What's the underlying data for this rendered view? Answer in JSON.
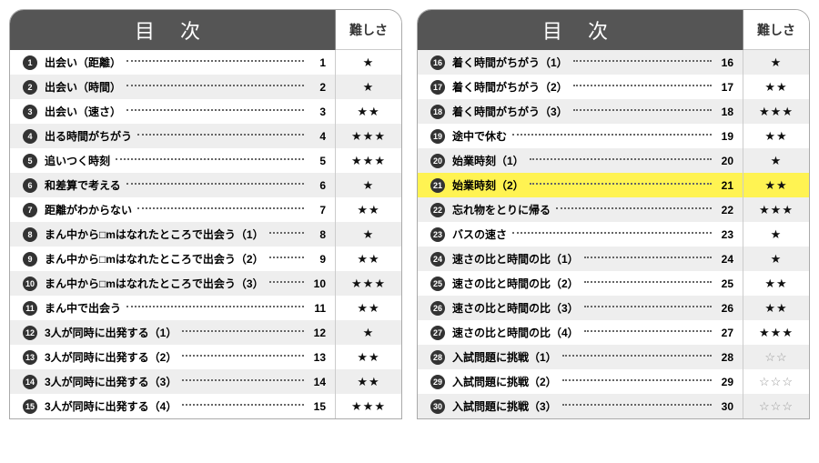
{
  "header": {
    "title": "目 次",
    "difficulty": "難しさ"
  },
  "stars": {
    "filled": "★",
    "open": "☆"
  },
  "left": [
    {
      "n": 1,
      "title": "出会い（距離）",
      "page": 1,
      "stars": 1,
      "open": false,
      "alt": false
    },
    {
      "n": 2,
      "title": "出会い（時間）",
      "page": 2,
      "stars": 1,
      "open": false,
      "alt": true
    },
    {
      "n": 3,
      "title": "出会い（速さ）",
      "page": 3,
      "stars": 2,
      "open": false,
      "alt": false
    },
    {
      "n": 4,
      "title": "出る時間がちがう",
      "page": 4,
      "stars": 3,
      "open": false,
      "alt": true
    },
    {
      "n": 5,
      "title": "追いつく時刻",
      "page": 5,
      "stars": 3,
      "open": false,
      "alt": false
    },
    {
      "n": 6,
      "title": "和差算で考える",
      "page": 6,
      "stars": 1,
      "open": false,
      "alt": true
    },
    {
      "n": 7,
      "title": "距離がわからない",
      "page": 7,
      "stars": 2,
      "open": false,
      "alt": false
    },
    {
      "n": 8,
      "title": "まん中から□mはなれたところで出会う（1）",
      "page": 8,
      "stars": 1,
      "open": false,
      "alt": true
    },
    {
      "n": 9,
      "title": "まん中から□mはなれたところで出会う（2）",
      "page": 9,
      "stars": 2,
      "open": false,
      "alt": false
    },
    {
      "n": 10,
      "title": "まん中から□mはなれたところで出会う（3）",
      "page": 10,
      "stars": 3,
      "open": false,
      "alt": true
    },
    {
      "n": 11,
      "title": "まん中で出会う",
      "page": 11,
      "stars": 2,
      "open": false,
      "alt": false
    },
    {
      "n": 12,
      "title": "3人が同時に出発する（1）",
      "page": 12,
      "stars": 1,
      "open": false,
      "alt": true
    },
    {
      "n": 13,
      "title": "3人が同時に出発する（2）",
      "page": 13,
      "stars": 2,
      "open": false,
      "alt": false
    },
    {
      "n": 14,
      "title": "3人が同時に出発する（3）",
      "page": 14,
      "stars": 2,
      "open": false,
      "alt": true
    },
    {
      "n": 15,
      "title": "3人が同時に出発する（4）",
      "page": 15,
      "stars": 3,
      "open": false,
      "alt": false
    }
  ],
  "right": [
    {
      "n": 16,
      "title": "着く時間がちがう（1）",
      "page": 16,
      "stars": 1,
      "open": false,
      "alt": true
    },
    {
      "n": 17,
      "title": "着く時間がちがう（2）",
      "page": 17,
      "stars": 2,
      "open": false,
      "alt": false
    },
    {
      "n": 18,
      "title": "着く時間がちがう（3）",
      "page": 18,
      "stars": 3,
      "open": false,
      "alt": true
    },
    {
      "n": 19,
      "title": "途中で休む",
      "page": 19,
      "stars": 2,
      "open": false,
      "alt": false
    },
    {
      "n": 20,
      "title": "始業時刻（1）",
      "page": 20,
      "stars": 1,
      "open": false,
      "alt": true
    },
    {
      "n": 21,
      "title": "始業時刻（2）",
      "page": 21,
      "stars": 2,
      "open": false,
      "alt": false,
      "highlight": true
    },
    {
      "n": 22,
      "title": "忘れ物をとりに帰る",
      "page": 22,
      "stars": 3,
      "open": false,
      "alt": true
    },
    {
      "n": 23,
      "title": "バスの速さ",
      "page": 23,
      "stars": 1,
      "open": false,
      "alt": false
    },
    {
      "n": 24,
      "title": "速さの比と時間の比（1）",
      "page": 24,
      "stars": 1,
      "open": false,
      "alt": true
    },
    {
      "n": 25,
      "title": "速さの比と時間の比（2）",
      "page": 25,
      "stars": 2,
      "open": false,
      "alt": false
    },
    {
      "n": 26,
      "title": "速さの比と時間の比（3）",
      "page": 26,
      "stars": 2,
      "open": false,
      "alt": true
    },
    {
      "n": 27,
      "title": "速さの比と時間の比（4）",
      "page": 27,
      "stars": 3,
      "open": false,
      "alt": false
    },
    {
      "n": 28,
      "title": "入試問題に挑戦（1）",
      "page": 28,
      "stars": 2,
      "open": true,
      "alt": true
    },
    {
      "n": 29,
      "title": "入試問題に挑戦（2）",
      "page": 29,
      "stars": 3,
      "open": true,
      "alt": false
    },
    {
      "n": 30,
      "title": "入試問題に挑戦（3）",
      "page": 30,
      "stars": 3,
      "open": true,
      "alt": true
    }
  ]
}
